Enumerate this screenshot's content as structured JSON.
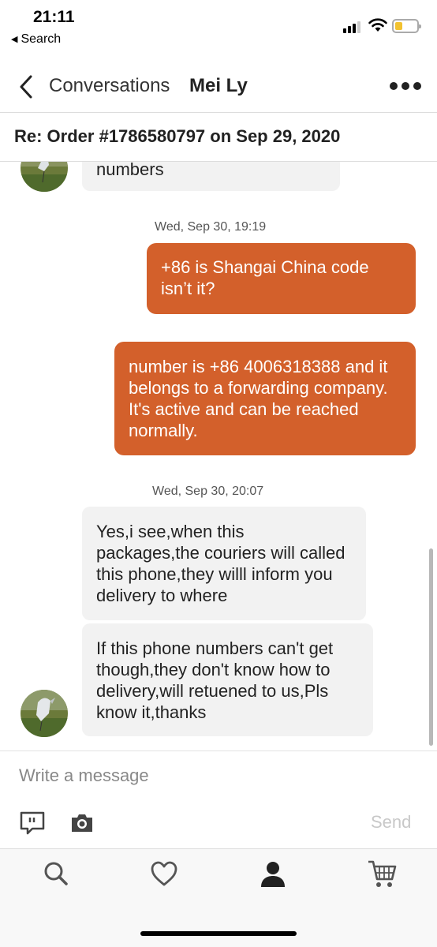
{
  "status_bar": {
    "time": "21:11",
    "back_app": "Search"
  },
  "header": {
    "back_label": "Conversations",
    "contact_name": "Mei Ly"
  },
  "subject": "Re: Order #1786580797 on Sep 29, 2020",
  "messages": [
    {
      "from": "them",
      "text": "numbers"
    },
    {
      "from": "timestamp",
      "text": "Wed, Sep 30, 19:19"
    },
    {
      "from": "me",
      "text": "+86 is Shangai China code isn’t it?"
    },
    {
      "from": "me",
      "text": "number is +86 4006318388 and it belongs to a forwarding company. It's active and can be reached normally."
    },
    {
      "from": "timestamp",
      "text": "Wed, Sep 30, 20:07"
    },
    {
      "from": "them",
      "text": "Yes,i see,when this packages,the couriers will called this phone,they willl inform you delivery to where"
    },
    {
      "from": "them",
      "text": "If this phone numbers can't get though,they don't know how to delivery,will retuened to us,Pls know it,thanks"
    }
  ],
  "composer": {
    "placeholder": "Write a message",
    "send_label": "Send"
  },
  "tabs": [
    "search-icon",
    "heart-icon",
    "profile-icon",
    "cart-icon"
  ],
  "colors": {
    "outgoing_bubble": "#d3602b",
    "incoming_bubble": "#f2f2f2",
    "battery": "#f2c230"
  }
}
